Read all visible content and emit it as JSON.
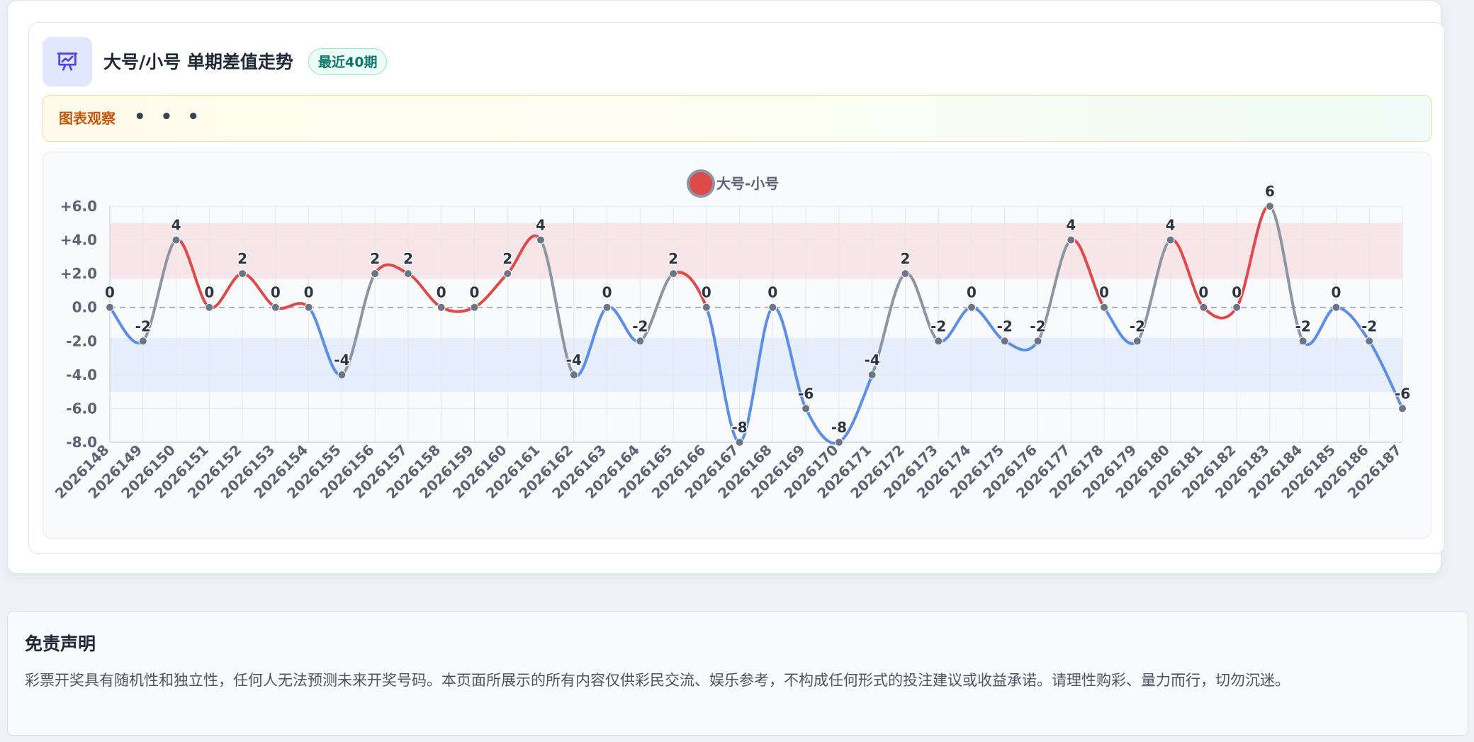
{
  "header": {
    "title": "大号/小号 单期差值走势",
    "badge": "最近40期",
    "icon": "presentation-chart-icon"
  },
  "observation": {
    "label": "图表观察",
    "more": "• • •"
  },
  "colors": {
    "positive": "#dc4a4a",
    "negative": "#5b8ee6",
    "neutral": "#8b95a4",
    "point": "#6b7585",
    "accent_bg": "#e0e7ff",
    "accent_icon": "#4f46e5"
  },
  "chart_data": {
    "type": "line",
    "categories": [
      "2026148",
      "2026149",
      "2026150",
      "2026151",
      "2026152",
      "2026153",
      "2026154",
      "2026155",
      "2026156",
      "2026157",
      "2026158",
      "2026159",
      "2026160",
      "2026161",
      "2026162",
      "2026163",
      "2026164",
      "2026165",
      "2026166",
      "2026167",
      "2026168",
      "2026169",
      "2026170",
      "2026171",
      "2026172",
      "2026173",
      "2026174",
      "2026175",
      "2026176",
      "2026177",
      "2026178",
      "2026179",
      "2026180",
      "2026181",
      "2026182",
      "2026183",
      "2026184",
      "2026185",
      "2026186",
      "2026187"
    ],
    "series": [
      {
        "name": "大号-小号",
        "values": [
          0,
          -2,
          4,
          0,
          2,
          0,
          0,
          -4,
          2,
          2,
          0,
          0,
          2,
          4,
          -4,
          0,
          -2,
          2,
          0,
          -8,
          0,
          -6,
          -8,
          -4,
          2,
          -2,
          0,
          -2,
          -2,
          4,
          0,
          -2,
          4,
          0,
          0,
          6,
          -2,
          0,
          -2,
          -6
        ]
      }
    ],
    "ylim": [
      -8,
      6
    ],
    "yticks": [
      "+6.0",
      "+4.0",
      "+2.0",
      "0.0",
      "-2.0",
      "-4.0",
      "-6.0",
      "-8.0"
    ],
    "bands": {
      "high": [
        1.7,
        5.0
      ],
      "low": [
        -5.0,
        -1.8
      ]
    },
    "zero_line": "dashed",
    "grid": true,
    "legend": "top-center",
    "curve": "smooth"
  },
  "disclaimer": {
    "title": "免责声明",
    "text": "彩票开奖具有随机性和独立性，任何人无法预测未来开奖号码。本页面所展示的所有内容仅供彩民交流、娱乐参考，不构成任何形式的投注建议或收益承诺。请理性购彩、量力而行，切勿沉迷。"
  }
}
